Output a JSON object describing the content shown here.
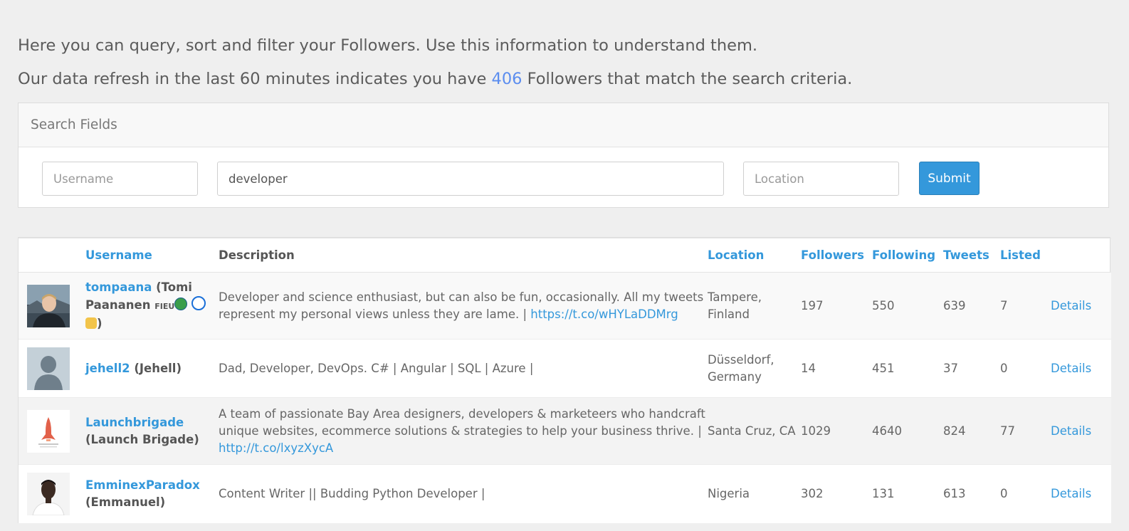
{
  "intro": {
    "line1": "Here you can query, sort and filter your Followers. Use this information to understand them.",
    "line2_prefix": "Our data refresh in the last 60 minutes indicates you have ",
    "line2_count": "406",
    "line2_suffix": " Followers that match the search criteria."
  },
  "search": {
    "heading": "Search Fields",
    "username_placeholder": "Username",
    "username_value": "",
    "description_value": "developer",
    "location_placeholder": "Location",
    "location_value": "",
    "submit_label": "Submit"
  },
  "table": {
    "headers": {
      "username": "Username",
      "description": "Description",
      "location": "Location",
      "followers": "Followers",
      "following": "Following",
      "tweets": "Tweets",
      "listed": "Listed"
    },
    "details_label": "Details",
    "rows": [
      {
        "username": "tompaana",
        "realname_open": " (Tomi Paananen ",
        "realname_tag": "FIEU",
        "realname_close": ")",
        "description": "Developer and science enthusiast, but can also be fun, occasionally. All my tweets represent my personal views unless they are lame. | ",
        "description_link": "https://t.co/wHYLaDDMrg",
        "location": "Tampere, Finland",
        "followers": "197",
        "following": "550",
        "tweets": "639",
        "listed": "7"
      },
      {
        "username": "jehell2",
        "realname": " (Jehell)",
        "description": "Dad, Developer, DevOps. C# | Angular | SQL | Azure |",
        "location": "Düsseldorf, Germany",
        "followers": "14",
        "following": "451",
        "tweets": "37",
        "listed": "0"
      },
      {
        "username": "Launchbrigade",
        "realname": "(Launch Brigade)",
        "description": "A team of passionate Bay Area designers, developers & marketeers who handcraft unique websites, ecommerce solutions & strategies to help your business thrive. | ",
        "description_link": "http://t.co/lxyzXycA",
        "location": "Santa Cruz, CA",
        "followers": "1029",
        "following": "4640",
        "tweets": "824",
        "listed": "77"
      },
      {
        "username": "EmminexParadox",
        "realname": "(Emmanuel)",
        "description": "Content Writer || Budding Python Developer |",
        "location": "Nigeria",
        "followers": "302",
        "following": "131",
        "tweets": "613",
        "listed": "0"
      }
    ]
  },
  "colors": {
    "accent": "#3498db",
    "count": "#5b8def",
    "background": "#efefef"
  }
}
